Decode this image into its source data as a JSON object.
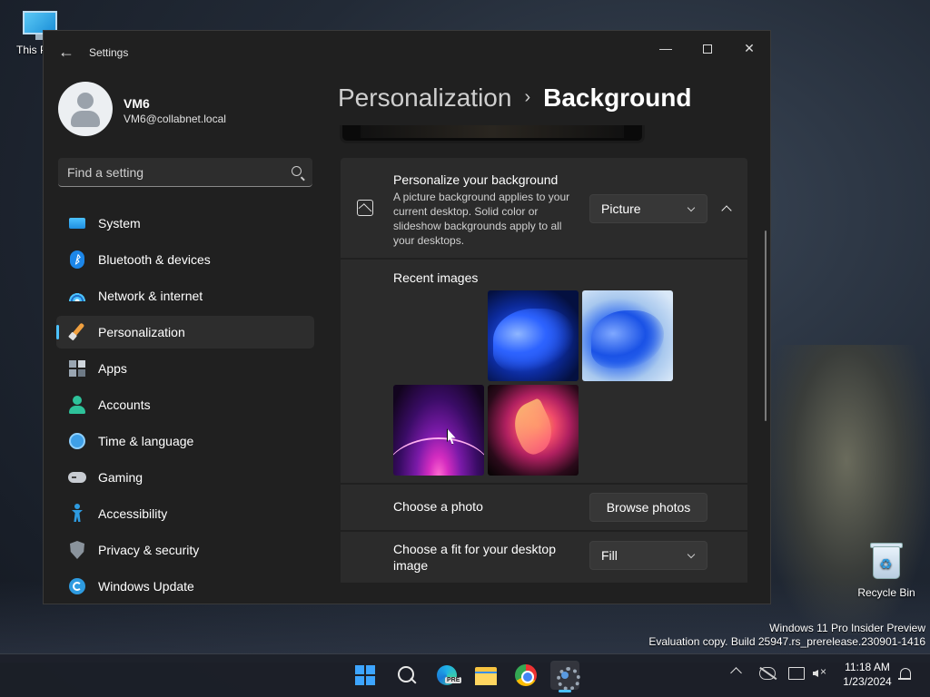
{
  "desktop": {
    "this_pc_label": "This P",
    "recycle_bin_label": "Recycle Bin",
    "watermark_line1": "Windows 11 Pro Insider Preview",
    "watermark_line2": "Evaluation copy. Build 25947.rs_prerelease.230901-1416"
  },
  "window": {
    "title": "Settings",
    "controls": {
      "minimize": "—",
      "close": "✕"
    }
  },
  "user": {
    "name": "VM6",
    "email": "VM6@collabnet.local"
  },
  "search": {
    "placeholder": "Find a setting"
  },
  "nav": {
    "items": [
      {
        "label": "System",
        "icon": "system-icon"
      },
      {
        "label": "Bluetooth & devices",
        "icon": "bluetooth-icon"
      },
      {
        "label": "Network & internet",
        "icon": "wifi-icon"
      },
      {
        "label": "Personalization",
        "icon": "brush-icon",
        "active": true
      },
      {
        "label": "Apps",
        "icon": "apps-icon"
      },
      {
        "label": "Accounts",
        "icon": "person-icon"
      },
      {
        "label": "Time & language",
        "icon": "clock-globe-icon"
      },
      {
        "label": "Gaming",
        "icon": "gamepad-icon"
      },
      {
        "label": "Accessibility",
        "icon": "accessibility-icon"
      },
      {
        "label": "Privacy & security",
        "icon": "shield-icon"
      },
      {
        "label": "Windows Update",
        "icon": "update-icon"
      }
    ]
  },
  "breadcrumb": {
    "parent": "Personalization",
    "separator": "›",
    "current": "Background"
  },
  "background": {
    "title": "Personalize your background",
    "description": "A picture background applies to your current desktop. Solid color or slideshow backgrounds apply to all your desktops.",
    "type_value": "Picture",
    "recent_label": "Recent images",
    "choose_photo_label": "Choose a photo",
    "browse_button": "Browse photos",
    "fit_label": "Choose a fit for your desktop image",
    "fit_value": "Fill"
  },
  "taskbar": {
    "edge_badge": "PRE",
    "time": "11:18 AM",
    "date": "1/23/2024"
  },
  "colors": {
    "accent": "#4cc2ff",
    "window_bg": "#202020",
    "card_bg": "#2b2b2b"
  }
}
